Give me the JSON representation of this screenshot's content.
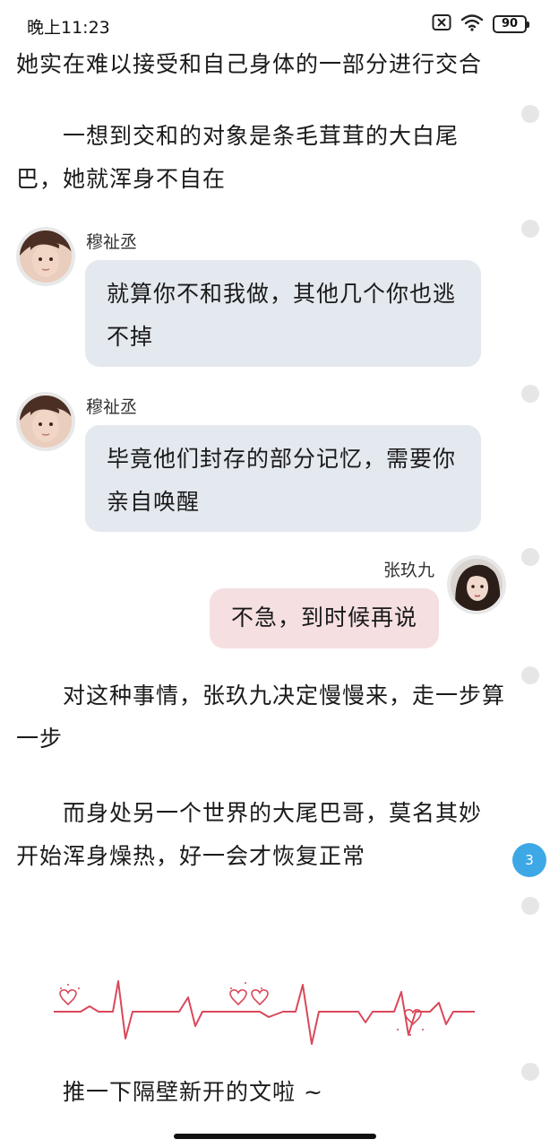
{
  "status_bar": {
    "time": "晚上11:23",
    "battery": "90",
    "icons": [
      "sim-off-icon",
      "wifi-icon",
      "battery-icon"
    ]
  },
  "paragraphs": [
    "她实在难以接受和自己身体的一部分进行交合",
    "一想到交和的对象是条毛茸茸的大白尾巴，她就浑身不自在",
    "对这种事情，张玖九决定慢慢来，走一步算一步",
    "而身处另一个世界的大尾巴哥，莫名其妙开始浑身燥热，好一会才恢复正常",
    "推一下隔壁新开的文啦 ~"
  ],
  "chat": [
    {
      "speaker": "穆祉丞",
      "side": "left",
      "text": "就算你不和我做，其他几个你也逃不掉"
    },
    {
      "speaker": "穆祉丞",
      "side": "left",
      "text": "毕竟他们封存的部分记忆，需要你亲自唤醒"
    },
    {
      "speaker": "张玖九",
      "side": "right",
      "text": "不急，到时候再说"
    }
  ],
  "comment_count": "3",
  "colors": {
    "left_bubble": "#e4e8ef",
    "right_bubble": "#f5dfe1",
    "badge": "#3ea8e6",
    "heartbeat_line": "#d9485a"
  }
}
